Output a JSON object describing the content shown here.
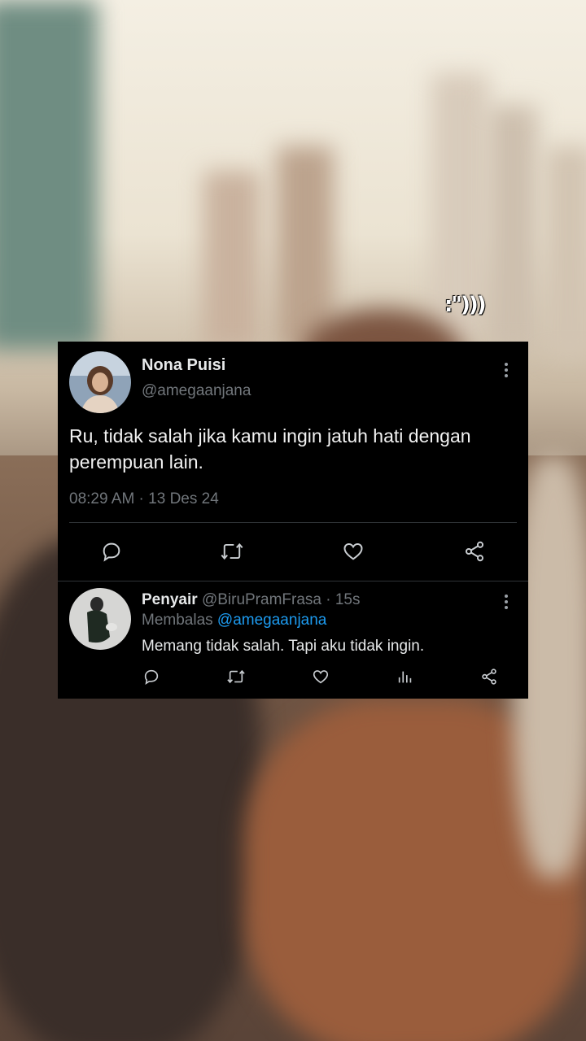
{
  "main_tweet": {
    "display_name": "Nona Puisi",
    "handle": "@amegaanjana",
    "text": "Ru, tidak salah jika kamu ingin jatuh hati dengan perempuan lain.",
    "timestamp": "08:29 AM · 13 Des 24",
    "actions": [
      "reply-icon",
      "retweet-icon",
      "like-icon",
      "share-icon"
    ]
  },
  "reply_tweet": {
    "display_name": "Penyair",
    "handle": "@BiruPramFrasa",
    "time": " · 15s",
    "replying_prefix": "Membalas ",
    "replying_to": "@amegaanjana",
    "text": "Memang tidak salah. Tapi aku tidak ingin.",
    "actions": [
      "reply-icon",
      "retweet-icon",
      "like-icon",
      "views-icon",
      "share-icon"
    ]
  },
  "sticker_text": ":\")))",
  "colors": {
    "card_bg": "#000000",
    "text": "#e7e9ea",
    "muted": "#71767b",
    "link": "#1d9bf0",
    "divider": "#2f3336"
  }
}
